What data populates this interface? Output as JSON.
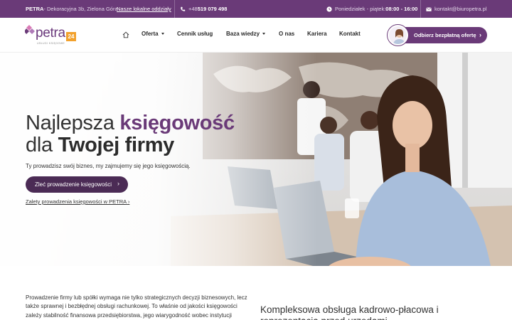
{
  "topbar": {
    "company": "PETRA",
    "address": " - Dekoracyjna 3b, Zielona Góra",
    "offices_link": "Nasze lokalne oddziały",
    "phone_prefix": "+48 ",
    "phone": "519 079 498",
    "hours_label": "Poniedziałek - piątek: ",
    "hours": "08:00 - 16:00",
    "email": "kontakt@biuropetra.pl"
  },
  "logo": {
    "brand": "petra",
    "badge": "24",
    "tagline": "USŁUGI KSIĘGOWE"
  },
  "nav": {
    "items": [
      {
        "label": "Oferta"
      },
      {
        "label": "Cennik usług"
      },
      {
        "label": "Baza wiedzy"
      },
      {
        "label": "O nas"
      },
      {
        "label": "Kariera"
      },
      {
        "label": "Kontakt"
      }
    ],
    "cta": "Odbierz bezpłatną ofertę"
  },
  "hero": {
    "title_part1": "Najlepsza ",
    "title_accent": "księgowość",
    "title_part2": "dla ",
    "title_bold": "Twojej firmy",
    "subtitle": "Ty prowadzisz swój biznes, my zajmujemy się jego księgowością.",
    "primary_button": "Zleć prowadzenie księgowości",
    "secondary_link": "Zalety prowadzenia księgowości w PETRA"
  },
  "content": {
    "paragraph": "Prowadzenie firmy lub spółki wymaga nie tylko strategicznych decyzji biznesowych, lecz także sprawnej i bezbłędnej obsługi rachunkowej. To właśnie od jakości księgowości zależy stabilność finansowa przedsiębiorstwa, jego wiarygodność wobec instytucji państwowych oraz możliwość dynamicznego rozwoju. Biuro Księgowe",
    "heading": "Kompleksowa obsługa kadrowo-płacowa i reprezentacja przed urzędami"
  },
  "colors": {
    "brand_purple": "#6a3a78",
    "button_dark": "#4b2b55",
    "badge_orange": "#f2a12c"
  }
}
